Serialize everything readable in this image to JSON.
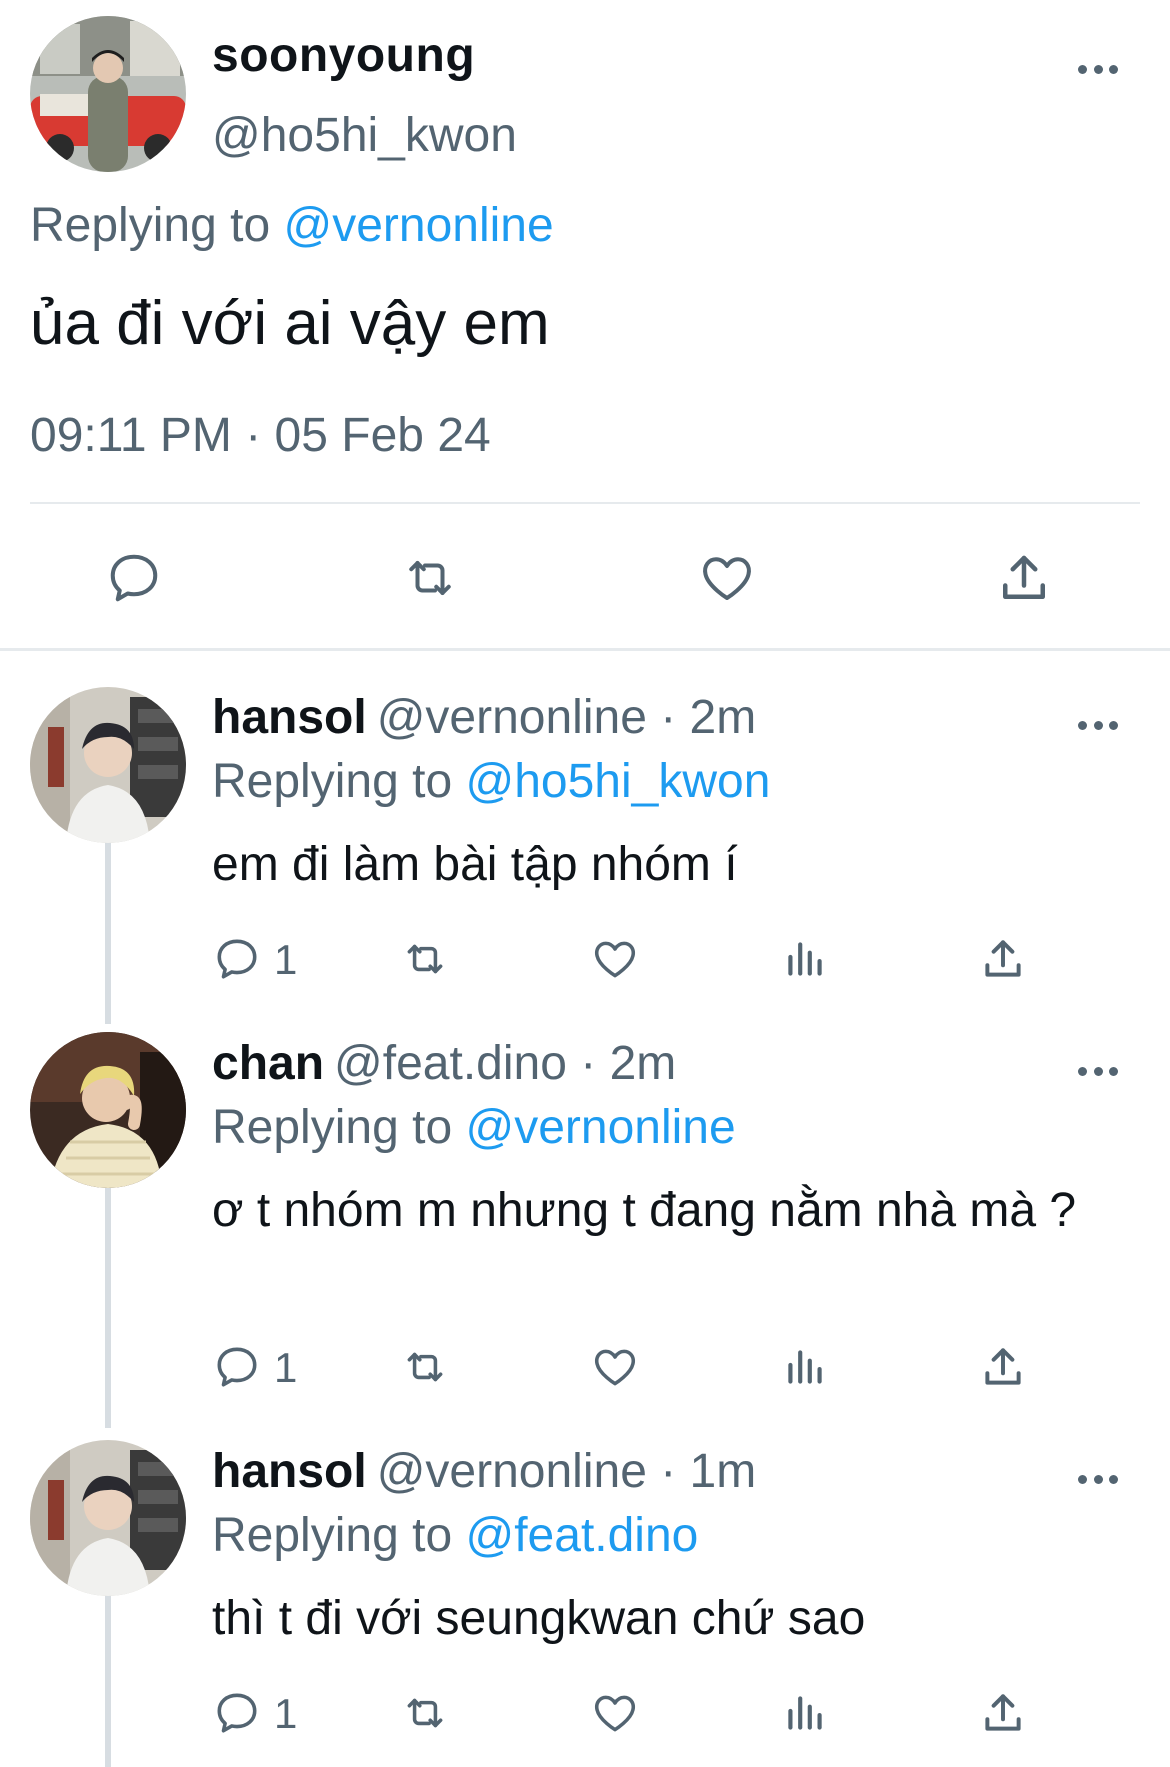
{
  "main_tweet": {
    "display_name": "soonyoung",
    "handle": "@ho5hi_kwon",
    "replying_prefix": "Replying to",
    "replying_to": "@vernonline",
    "text": "ủa đi với ai vậy em",
    "timestamp": "09:11 PM · 05 Feb 24",
    "actions": [
      "reply-icon",
      "retweet-icon",
      "like-icon",
      "share-icon"
    ]
  },
  "replies": [
    {
      "display_name": "hansol",
      "meta": "@vernonline · 2m",
      "replying_prefix": "Replying to",
      "replying_to": "@ho5hi_kwon",
      "text": "em đi làm bài tập nhóm í",
      "reply_count": "1"
    },
    {
      "display_name": "chan",
      "meta": "@feat.dino · 2m",
      "replying_prefix": "Replying to",
      "replying_to": "@vernonline",
      "text": "ơ t nhóm m nhưng t đang nằm nhà mà ?",
      "reply_count": "1"
    },
    {
      "display_name": "hansol",
      "meta": "@vernonline · 1m",
      "replying_prefix": "Replying to",
      "replying_to": "@feat.dino",
      "text": "thì t đi với seungkwan chứ sao",
      "reply_count": "1"
    }
  ],
  "colors": {
    "text": "#0f1419",
    "secondary": "#536471",
    "link": "#1d9bf0",
    "divider": "#e6eaed"
  }
}
